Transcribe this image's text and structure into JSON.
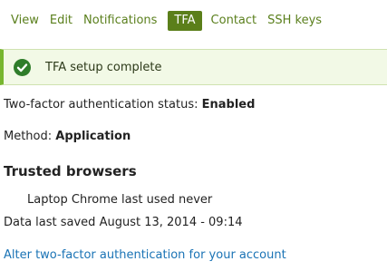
{
  "tabs": [
    {
      "label": "View"
    },
    {
      "label": "Edit"
    },
    {
      "label": "Notifications"
    },
    {
      "label": "TFA"
    },
    {
      "label": "Contact"
    },
    {
      "label": "SSH keys"
    }
  ],
  "active_tab": "TFA",
  "status_message": {
    "icon": "check-circle-icon",
    "text": "TFA setup complete"
  },
  "tfa_status": {
    "label": "Two-factor authentication status: ",
    "value": "Enabled"
  },
  "method": {
    "label": "Method: ",
    "value": "Application"
  },
  "trusted_browsers": {
    "heading": "Trusted browsers",
    "items": [
      "Laptop Chrome last used never"
    ]
  },
  "data_saved": "Data last saved August 13, 2014 - 09:14",
  "alter_link": "Alter two-factor authentication for your account",
  "colors": {
    "accent": "#5b7f1a",
    "status_bg": "#f2f9e6",
    "status_border": "#77b62f",
    "link": "#1a73b5"
  }
}
